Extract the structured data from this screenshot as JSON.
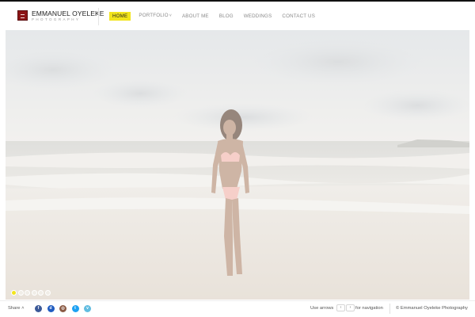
{
  "brand": {
    "name": "EMMANUEL OYELEKE",
    "tagline": "PHOTOGRAPHY"
  },
  "nav": {
    "items": [
      {
        "label": "HOME",
        "active": true
      },
      {
        "label": "PORTFOLIO",
        "has_dropdown": true,
        "dropdown_icon": "chevron-down-icon"
      },
      {
        "label": "ABOUT ME"
      },
      {
        "label": "BLOG"
      },
      {
        "label": "WEDDINGS"
      },
      {
        "label": "CONTACT US"
      }
    ],
    "active_color": "#f2e41c"
  },
  "hero": {
    "image_content": "woman in pink bikini walking on beach at shore, overcast sky",
    "slide_count": 6,
    "active_slide": 1
  },
  "footer": {
    "share_label": "Share",
    "share_icon": "chevron-up-icon",
    "socials": [
      {
        "name": "facebook-icon",
        "glyph": "f",
        "color": "#3b5998"
      },
      {
        "name": "delicious-icon",
        "glyph": "d",
        "color": "#205cc0"
      },
      {
        "name": "instagram-icon",
        "glyph": "◎",
        "color": "#8a5a44"
      },
      {
        "name": "twitter-icon",
        "glyph": "t",
        "color": "#1da1f2"
      },
      {
        "name": "vimeo-icon",
        "glyph": "v",
        "color": "#62bde0"
      }
    ],
    "nav_hint_prefix": "Use arrows",
    "prev_key": "‹",
    "next_key": "›",
    "nav_hint_suffix": "for navigation",
    "copyright": "© Emmanuel Oyeleke Photography"
  }
}
